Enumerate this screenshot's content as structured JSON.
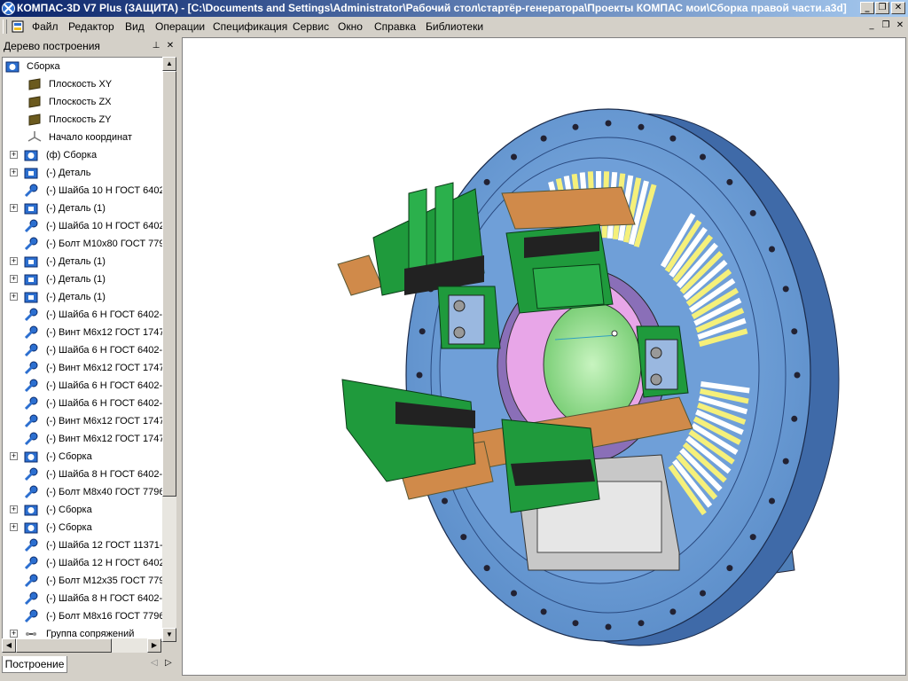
{
  "window": {
    "title": "КОМПАС-3D V7 Plus (ЗАЩИТА) - [C:\\Documents and Settings\\Administrator\\Рабочий стол\\стартёр-генератора\\Проекты КОМПАС мои\\Сборка правой части.a3d]",
    "minimize": "_",
    "restore": "❐",
    "close": "✕"
  },
  "menu": {
    "items": [
      "Файл",
      "Редактор",
      "Вид",
      "Операции",
      "Спецификация",
      "Сервис",
      "Окно",
      "Справка",
      "Библиотеки"
    ],
    "doc_minimize": "_",
    "doc_restore": "❐",
    "doc_close": "✕"
  },
  "panel": {
    "title": "Дерево построения",
    "pin": "⊥",
    "close": "✕",
    "tab": "Построение",
    "tab_prev": "◁",
    "tab_next": "▷"
  },
  "tree": [
    {
      "label": "Сборка",
      "icon": "assembly-icon",
      "expander": ""
    },
    {
      "label": "Плоскость XY",
      "icon": "plane-icon",
      "expander": ""
    },
    {
      "label": "Плоскость ZX",
      "icon": "plane-icon",
      "expander": ""
    },
    {
      "label": "Плоскость ZY",
      "icon": "plane-icon",
      "expander": ""
    },
    {
      "label": "Начало координат",
      "icon": "origin-icon",
      "expander": ""
    },
    {
      "label": "(ф) Сборка",
      "icon": "assembly-icon",
      "expander": "+"
    },
    {
      "label": "(-) Деталь",
      "icon": "part-icon",
      "expander": "+"
    },
    {
      "label": "(-) Шайба 10 Н ГОСТ 6402",
      "icon": "fastener-icon",
      "expander": ""
    },
    {
      "label": "(-) Деталь (1)",
      "icon": "part-icon",
      "expander": "+"
    },
    {
      "label": "(-) Шайба 10 Н ГОСТ 6402",
      "icon": "fastener-icon",
      "expander": ""
    },
    {
      "label": "(-) Болт М10х80 ГОСТ 779",
      "icon": "fastener-icon",
      "expander": ""
    },
    {
      "label": "(-) Деталь (1)",
      "icon": "part-icon",
      "expander": "+"
    },
    {
      "label": "(-) Деталь (1)",
      "icon": "part-icon",
      "expander": "+"
    },
    {
      "label": "(-) Деталь (1)",
      "icon": "part-icon",
      "expander": "+"
    },
    {
      "label": "(-) Шайба 6 Н ГОСТ 6402-",
      "icon": "fastener-icon",
      "expander": ""
    },
    {
      "label": "(-) Винт М6х12 ГОСТ 1747",
      "icon": "fastener-icon",
      "expander": ""
    },
    {
      "label": "(-) Шайба 6 Н ГОСТ 6402-",
      "icon": "fastener-icon",
      "expander": ""
    },
    {
      "label": "(-) Винт М6х12 ГОСТ 1747",
      "icon": "fastener-icon",
      "expander": ""
    },
    {
      "label": "(-) Шайба 6 Н ГОСТ 6402-",
      "icon": "fastener-icon",
      "expander": ""
    },
    {
      "label": "(-) Шайба 6 Н ГОСТ 6402-",
      "icon": "fastener-icon",
      "expander": ""
    },
    {
      "label": "(-) Винт М6х12 ГОСТ 1747",
      "icon": "fastener-icon",
      "expander": ""
    },
    {
      "label": "(-) Винт М6х12 ГОСТ 1747",
      "icon": "fastener-icon",
      "expander": ""
    },
    {
      "label": "(-) Сборка",
      "icon": "assembly-icon",
      "expander": "+"
    },
    {
      "label": "(-) Шайба 8 Н ГОСТ 6402-",
      "icon": "fastener-icon",
      "expander": ""
    },
    {
      "label": "(-) Болт М8х40 ГОСТ 7796",
      "icon": "fastener-icon",
      "expander": ""
    },
    {
      "label": "(-) Сборка",
      "icon": "assembly-icon",
      "expander": "+"
    },
    {
      "label": "(-) Сборка",
      "icon": "assembly-icon",
      "expander": "+"
    },
    {
      "label": "(-) Шайба 12 ГОСТ 11371-",
      "icon": "fastener-icon",
      "expander": ""
    },
    {
      "label": "(-) Шайба 12 Н ГОСТ 6402",
      "icon": "fastener-icon",
      "expander": ""
    },
    {
      "label": "(-) Болт М12х35 ГОСТ 779",
      "icon": "fastener-icon",
      "expander": ""
    },
    {
      "label": "(-) Шайба 8 Н ГОСТ 6402-",
      "icon": "fastener-icon",
      "expander": ""
    },
    {
      "label": "(-) Болт М8х16 ГОСТ 7796",
      "icon": "fastener-icon",
      "expander": ""
    },
    {
      "label": "Группа сопряжений",
      "icon": "mates-icon",
      "expander": "+"
    }
  ],
  "scroll": {
    "up": "▲",
    "down": "▼",
    "left": "◀",
    "right": "▶"
  },
  "colors": {
    "flange": "#6fa0d8",
    "flange_dark": "#4f7fb8",
    "fins": "#f5f07a",
    "brush_holder": "#1f9a3c",
    "copper_bar": "#d08a4a",
    "hub_pink": "#e8a6e8",
    "hub_green": "#9ee89a"
  }
}
